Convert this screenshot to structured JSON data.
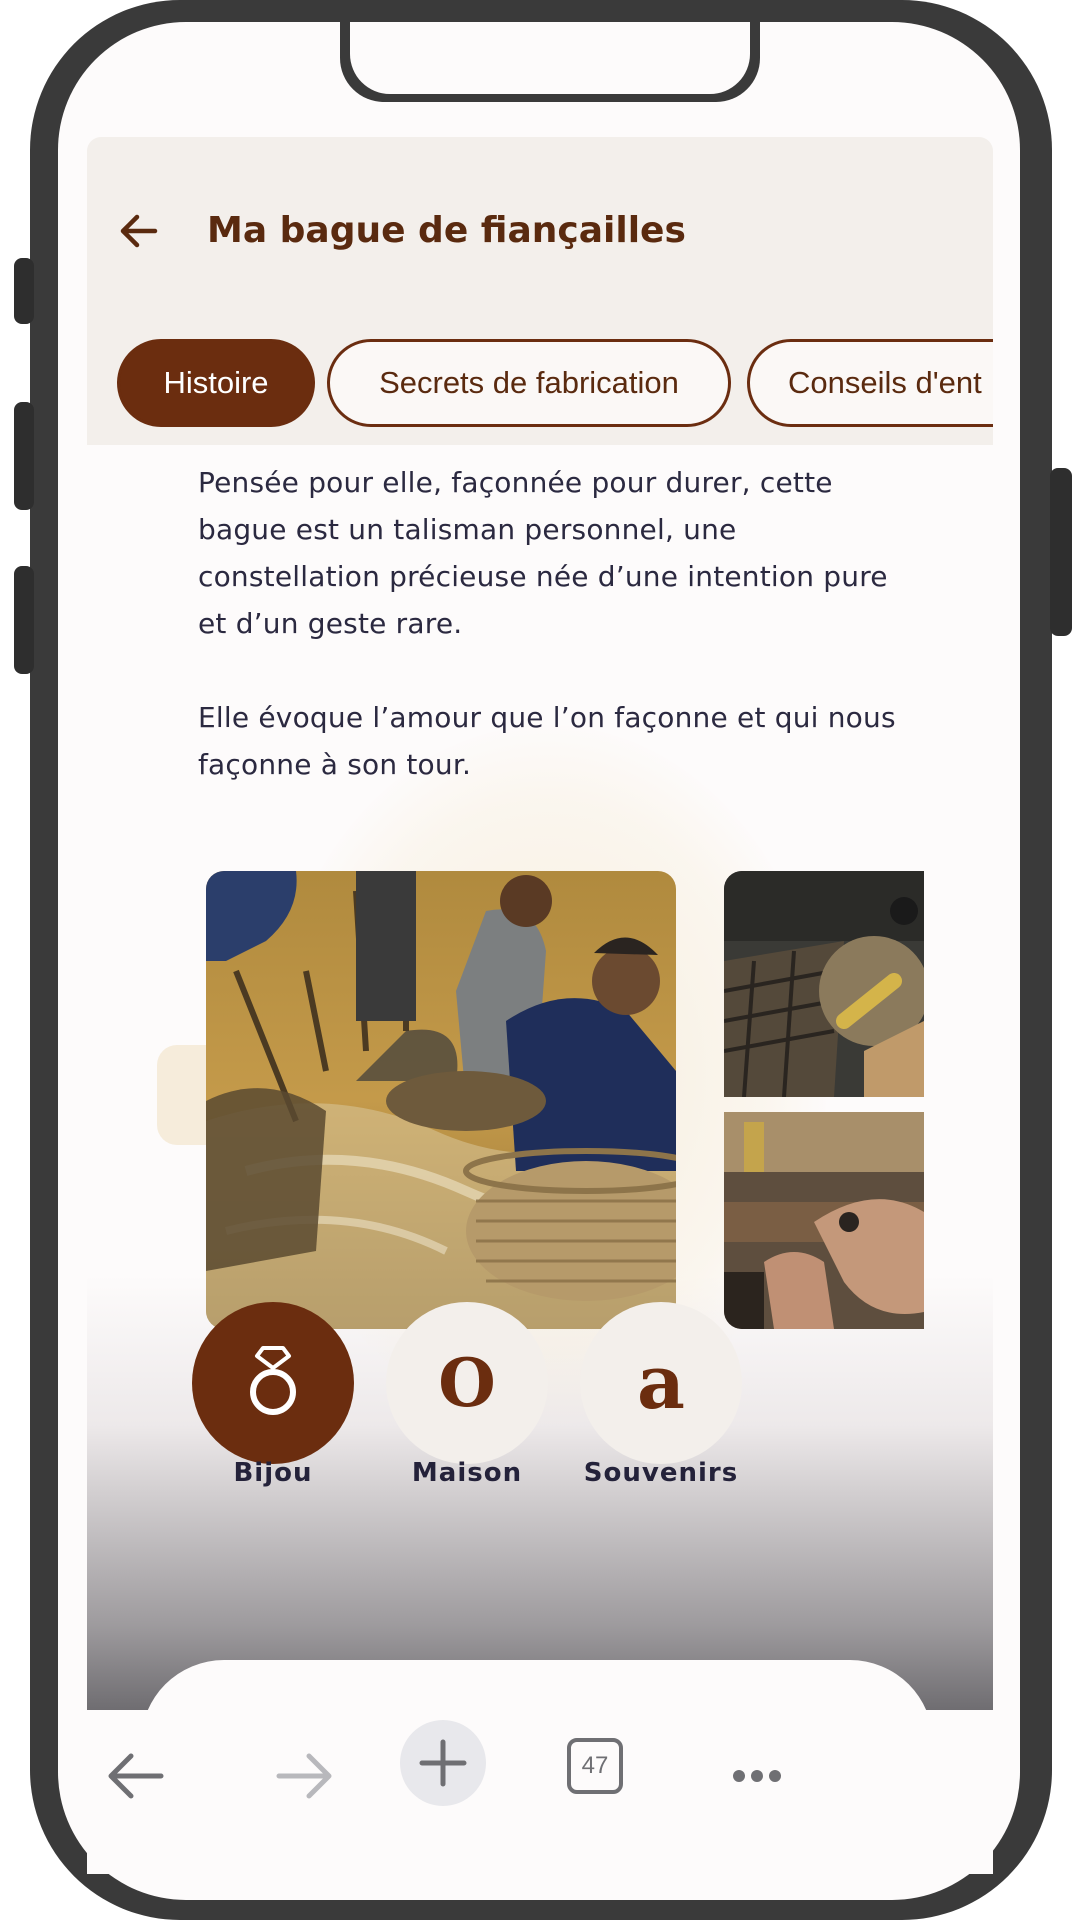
{
  "header": {
    "back_icon": "arrow-left-icon",
    "title": "Ma bague de fiançailles"
  },
  "tabs": [
    {
      "label": "Histoire",
      "active": true
    },
    {
      "label": "Secrets de fabrication",
      "active": false
    },
    {
      "label": "Conseils d'ent",
      "active": false
    }
  ],
  "content": {
    "paragraphs": [
      "Pensée pour elle, façonnée pour durer, cette bague est un talisman personnel, une constellation précieuse née d’une intention pure et d’un geste rare.",
      "Elle évoque l’amour que l’on façonne et qui nous façonne à son tour."
    ],
    "photos": [
      "artisans panning for gold in a river",
      "jeweler working with a torch",
      "hands setting a ring at a workbench"
    ]
  },
  "bottom_nav": {
    "items": [
      {
        "label": "Bijou",
        "icon": "diamond-ring-icon",
        "active": true
      },
      {
        "label": "Maison",
        "icon": "o-letter-icon",
        "glyph": "O",
        "active": false
      },
      {
        "label": "Souvenirs",
        "icon": "a-letter-icon",
        "glyph": "a",
        "active": false
      }
    ]
  },
  "browser": {
    "tab_count": "47",
    "icons": [
      "back-icon",
      "forward-icon",
      "new-tab-icon",
      "tabs-icon",
      "more-icon"
    ]
  },
  "colors": {
    "brand_brown": "#6b2d0f",
    "header_bg": "#f3efeb",
    "text_dark": "#2b2940"
  }
}
